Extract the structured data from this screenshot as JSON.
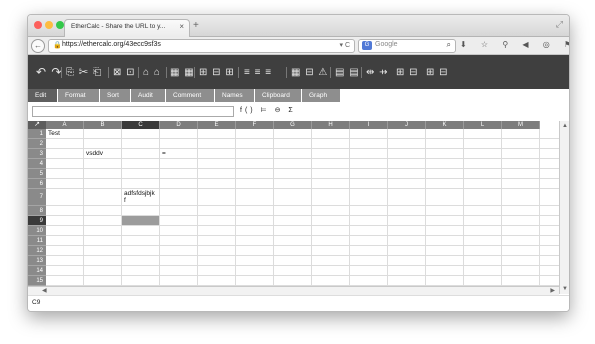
{
  "browser": {
    "tab_title": "EtherCalc - Share the URL to y...",
    "tab_close": "×",
    "new_tab": "+",
    "url": "https://ethercalc.org/43ecc9sf3s",
    "url_controls": "▾ C",
    "search_engine_label": "G",
    "search_placeholder": "Google",
    "search_icon": "⌕",
    "nav_icons": "⬇ ☆ ⚲ ◀ ◎ ⚑ ≡",
    "back_icon": "←",
    "lock_icon": "🔒",
    "resize_icon": "⤢",
    "traffic_colors": {
      "close": "#fc605c",
      "min": "#fdbc40",
      "max": "#34c84a"
    }
  },
  "toolbar": {
    "group1": "↶ ↷",
    "group2": "⎘ ✂ ⎗",
    "group3": "⊠ ⊡",
    "group4": "⌂ ⌂",
    "group5": "▦ ▦",
    "group6": "⊞ ⊟ ⊞",
    "group7": "≡ ≡ ≡",
    "group8": "▦ ⊟ ⚠",
    "group9": "▤ ▤",
    "group10": "⇹ ⇸",
    "group11": "⊞ ⊟",
    "group12": "⊞ ⊟"
  },
  "menu_tabs": [
    {
      "label": "Edit",
      "active": true
    },
    {
      "label": "Format"
    },
    {
      "label": "Sort"
    },
    {
      "label": "Audit"
    },
    {
      "label": "Comment"
    },
    {
      "label": "Names"
    },
    {
      "label": "Clipboard"
    },
    {
      "label": "Graph"
    }
  ],
  "formula": {
    "value": "",
    "buttons": "f() ⊨ ⊖ Σ"
  },
  "sheet": {
    "corner_icon": "↗",
    "columns": [
      "A",
      "B",
      "C",
      "D",
      "E",
      "F",
      "G",
      "H",
      "I",
      "J",
      "K",
      "L",
      "M"
    ],
    "selected_column": "C",
    "rows": [
      "1",
      "2",
      "3",
      "4",
      "5",
      "6",
      "7",
      "8",
      "9",
      "10",
      "11",
      "12",
      "13",
      "14",
      "15"
    ],
    "selected_row": "9",
    "cells": {
      "A1": "Test",
      "B3": "vsddv",
      "D3": "=",
      "C7": "adfsfdsjbjk\nf"
    }
  },
  "status": {
    "cell_ref": "C9"
  },
  "colors": {
    "toolbar_bg": "#3f3f3f",
    "menu_tab_bg": "#8e8e8e",
    "menu_tab_active": "#5f5f5f",
    "header_bg": "#7d7d7d",
    "selected_header_bg": "#3a3a3a"
  }
}
